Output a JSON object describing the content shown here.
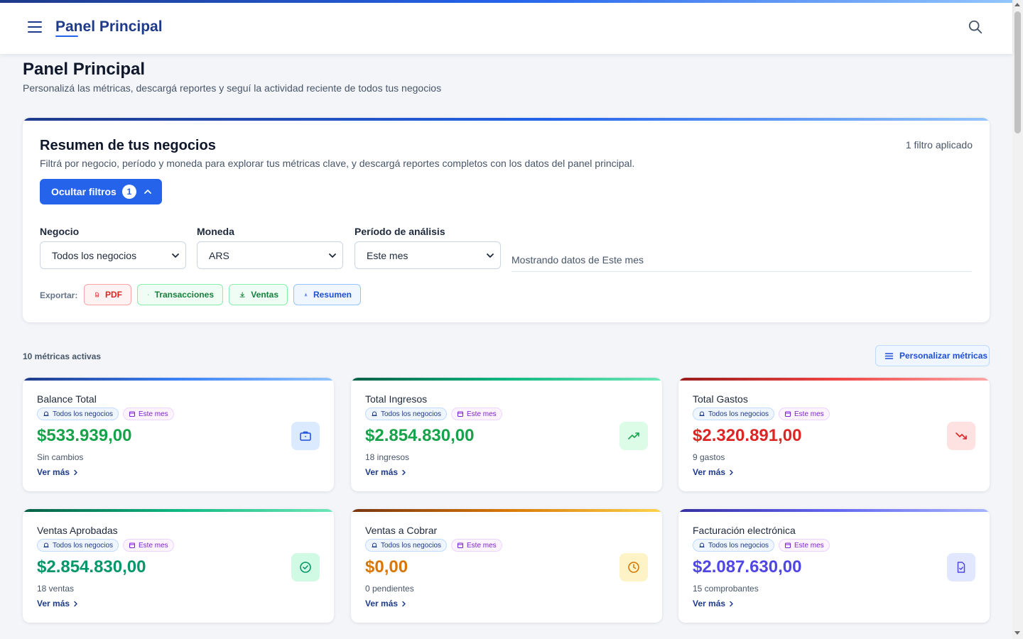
{
  "header": {
    "title": "Panel Principal"
  },
  "page": {
    "title": "Panel Principal",
    "subtitle": "Personalizá las métricas, descargá reportes y seguí la actividad reciente de todos tus negocios"
  },
  "summary": {
    "title": "Resumen de tus negocios",
    "description": "Filtrá por negocio, período y moneda para explorar tus métricas clave, y descargá reportes completos con los datos del panel principal.",
    "filter_count": "1 filtro aplicado",
    "toggle_label": "Ocultar filtros",
    "toggle_badge": "1",
    "filters": {
      "business_label": "Negocio",
      "business_value": "Todos los negocios",
      "currency_label": "Moneda",
      "currency_value": "ARS",
      "period_label": "Período de análisis",
      "period_value": "Este mes"
    },
    "showing_text": "Mostrando datos de Este mes",
    "export": {
      "label": "Exportar:",
      "pdf": "PDF",
      "transactions": "Transacciones",
      "sales": "Ventas",
      "summary": "Resumen"
    }
  },
  "metrics": {
    "count_label": "10 métricas activas",
    "customize_label": "Personalizar métricas",
    "cards": [
      {
        "title": "Balance Total",
        "chip_business": "Todos los negocios",
        "chip_period": "Este mes",
        "value": "$533.939,00",
        "sub": "Sin cambios",
        "link": "Ver más",
        "icon": "briefcase-icon",
        "value_color": "#16a34a"
      },
      {
        "title": "Total Ingresos",
        "chip_business": "Todos los negocios",
        "chip_period": "Este mes",
        "value": "$2.854.830,00",
        "sub": "18 ingresos",
        "link": "Ver más",
        "icon": "trending-up-icon",
        "value_color": "#16a34a"
      },
      {
        "title": "Total Gastos",
        "chip_business": "Todos los negocios",
        "chip_period": "Este mes",
        "value": "$2.320.891,00",
        "sub": "9 gastos",
        "link": "Ver más",
        "icon": "trending-down-icon",
        "value_color": "#dc2626"
      },
      {
        "title": "Ventas Aprobadas",
        "chip_business": "Todos los negocios",
        "chip_period": "Este mes",
        "value": "$2.854.830,00",
        "sub": "18 ventas",
        "link": "Ver más",
        "icon": "check-circle-icon",
        "value_color": "#059669"
      },
      {
        "title": "Ventas a Cobrar",
        "chip_business": "Todos los negocios",
        "chip_period": "Este mes",
        "value": "$0,00",
        "sub": "0 pendientes",
        "link": "Ver más",
        "icon": "clock-icon",
        "value_color": "#d97706"
      },
      {
        "title": "Facturación electrónica",
        "chip_business": "Todos los negocios",
        "chip_period": "Este mes",
        "value": "$2.087.630,00",
        "sub": "15 comprobantes",
        "link": "Ver más",
        "icon": "file-check-icon",
        "value_color": "#4f46e5"
      }
    ]
  }
}
